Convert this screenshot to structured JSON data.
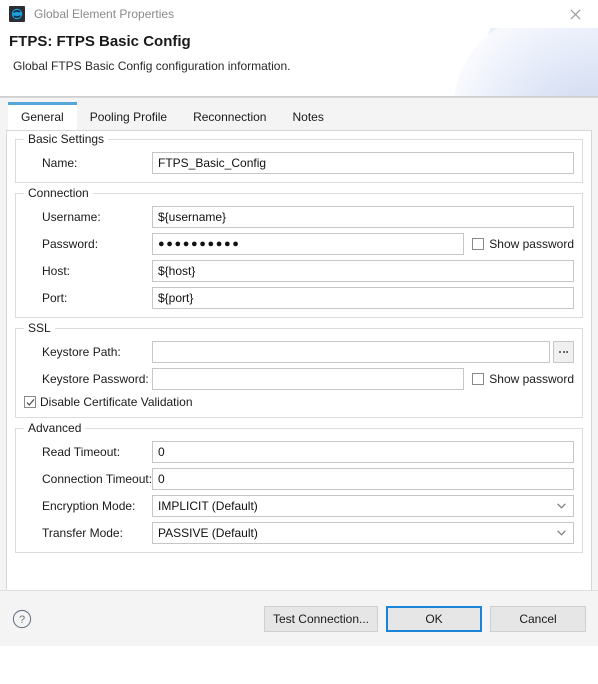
{
  "window": {
    "title": "Global Element Properties",
    "icon": "mule-config-icon",
    "close_label": "Close"
  },
  "header": {
    "title": "FTPS: FTPS Basic Config",
    "subtitle": "Global FTPS Basic Config configuration information."
  },
  "tabs": [
    {
      "label": "General",
      "active": true
    },
    {
      "label": "Pooling Profile",
      "active": false
    },
    {
      "label": "Reconnection",
      "active": false
    },
    {
      "label": "Notes",
      "active": false
    }
  ],
  "groups": {
    "basic_settings": {
      "title": "Basic Settings",
      "name_label": "Name:",
      "name_value": "FTPS_Basic_Config"
    },
    "connection": {
      "title": "Connection",
      "username_label": "Username:",
      "username_value": "${username}",
      "password_label": "Password:",
      "password_value": "●●●●●●●●●●",
      "password_show_label": "Show password",
      "host_label": "Host:",
      "host_value": "${host}",
      "port_label": "Port:",
      "port_value": "${port}"
    },
    "ssl": {
      "title": "SSL",
      "keystore_path_label": "Keystore Path:",
      "keystore_path_value": "",
      "browse_label": "...",
      "keystore_password_label": "Keystore Password:",
      "keystore_password_value": "",
      "keystore_show_label": "Show password",
      "disable_cert_label": "Disable Certificate Validation",
      "disable_cert_checked": true
    },
    "advanced": {
      "title": "Advanced",
      "read_timeout_label": "Read Timeout:",
      "read_timeout_value": "0",
      "connection_timeout_label": "Connection Timeout:",
      "connection_timeout_value": "0",
      "encryption_mode_label": "Encryption Mode:",
      "encryption_mode_value": "IMPLICIT (Default)",
      "transfer_mode_label": "Transfer Mode:",
      "transfer_mode_value": "PASSIVE (Default)"
    }
  },
  "footer": {
    "help_label": "?",
    "test_connection": "Test Connection...",
    "ok": "OK",
    "cancel": "Cancel"
  },
  "colors": {
    "accent_blue": "#54a7d8",
    "focus_blue": "#1a84d8",
    "panel_bg": "#f4f4f4",
    "field_border": "#c6c6c6"
  }
}
